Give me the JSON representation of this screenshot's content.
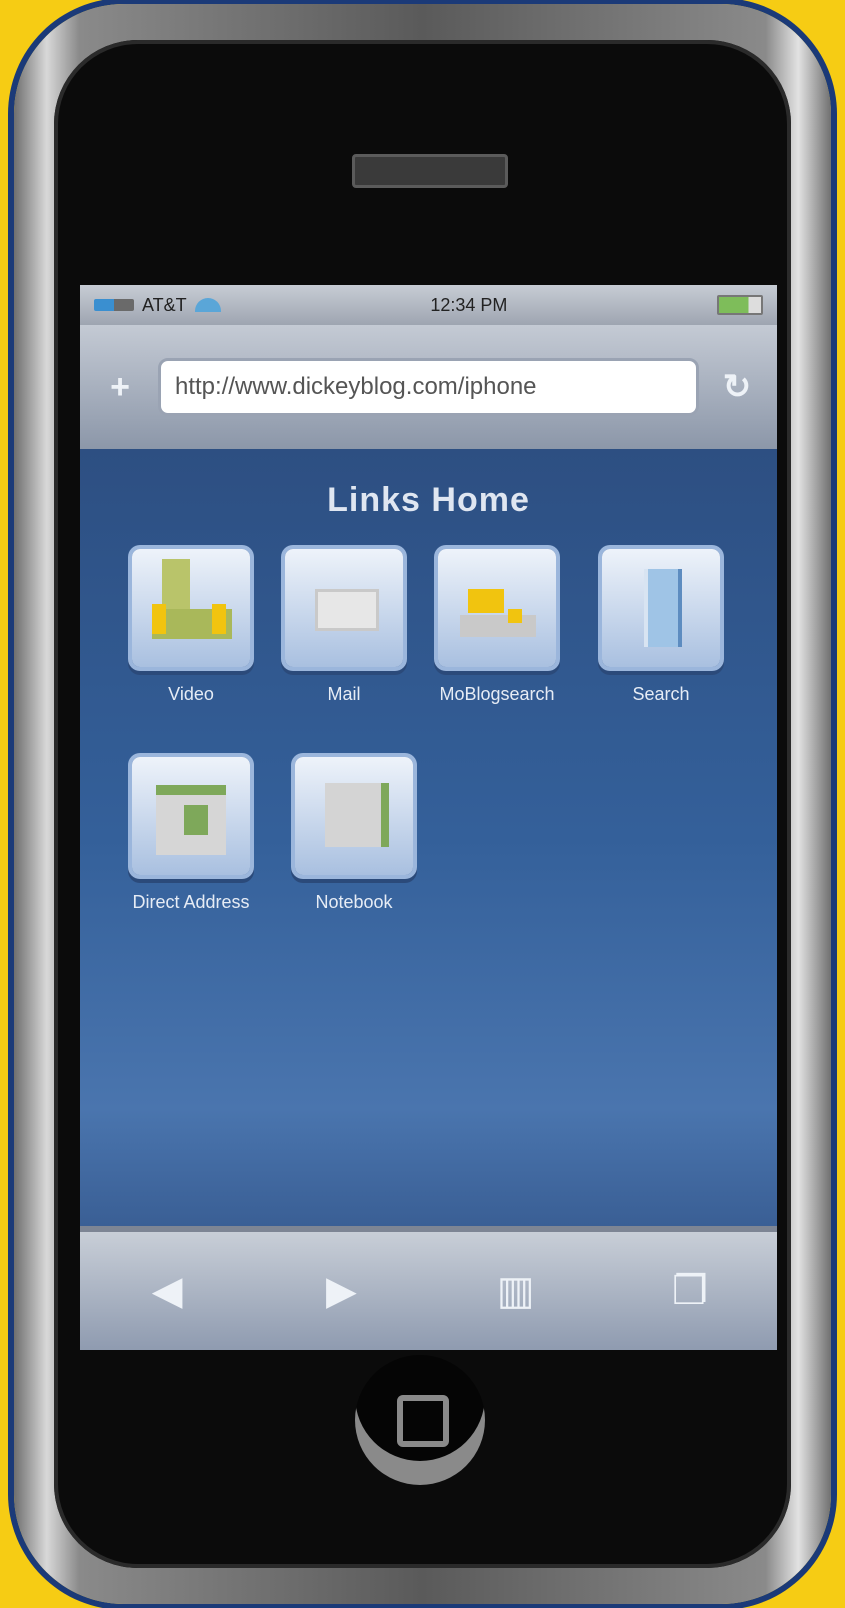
{
  "status_bar": {
    "carrier": "AT&T",
    "time": "12:34 PM"
  },
  "url_bar": {
    "url": "http://www.dickeyblog.com/iphone",
    "add_icon": "plus-icon",
    "reload_icon": "reload-icon"
  },
  "page": {
    "heading": "Links Home",
    "apps": [
      {
        "label": "Video"
      },
      {
        "label": "Mail"
      },
      {
        "label": "MoBlogsearch"
      },
      {
        "label": "Search"
      },
      {
        "label": "Direct Address"
      },
      {
        "label": "Notebook"
      }
    ]
  },
  "toolbar": {
    "back_icon": "back-arrow-icon",
    "forward_icon": "forward-arrow-icon",
    "bookmarks_icon": "bookmarks-icon",
    "pages_icon": "pages-icon"
  },
  "colors": {
    "background": "#f6cc14",
    "screen": "#2d5084",
    "accent": "#9bb6dc"
  }
}
